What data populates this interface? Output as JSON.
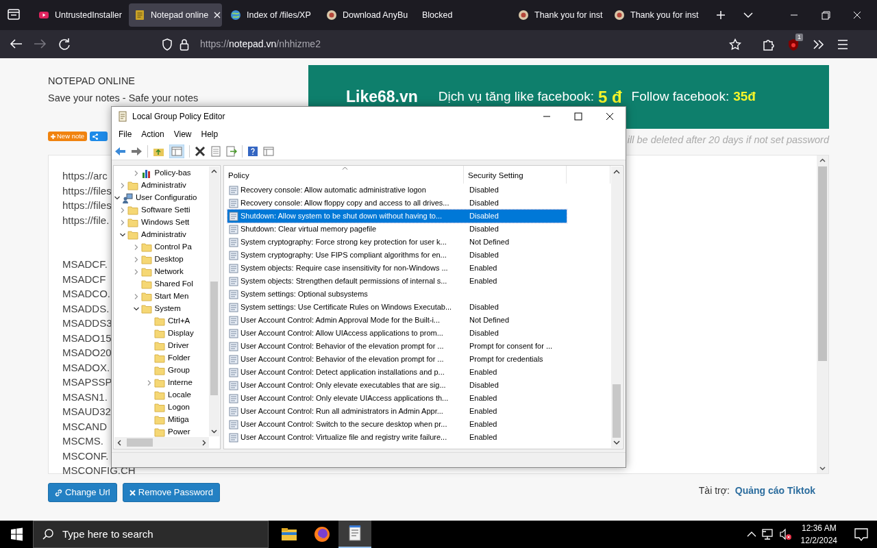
{
  "browser": {
    "tabs": [
      {
        "title": "UntrustedInstaller",
        "selected": false,
        "kind": "video"
      },
      {
        "title": "Notepad online",
        "selected": true,
        "kind": "note"
      },
      {
        "title": "Index of /files/XP",
        "selected": false,
        "kind": "globe"
      },
      {
        "title": "Download AnyBu",
        "selected": false,
        "kind": "site"
      },
      {
        "title": "Blocked",
        "selected": false,
        "kind": "plain"
      },
      {
        "title": "Thank you for inst",
        "selected": false,
        "kind": "site"
      },
      {
        "title": "Thank you for inst",
        "selected": false,
        "kind": "site"
      }
    ],
    "url": {
      "scheme": "https://",
      "host": "notepad.vn",
      "path": "/nhhizme2"
    },
    "extension_badge": "1"
  },
  "page": {
    "title": "NOTEPAD ONLINE",
    "subtitle": "Save your notes - Safe your notes",
    "new_note": "New note",
    "banner": {
      "brand": "Like68.vn",
      "offer_1": "Dịch vụ tăng like facebook:",
      "price_1": "5 đ",
      "offer_2": "Follow facebook:",
      "price_2": "35đ"
    },
    "notice": "ill be deleted after 20 days if not set password",
    "note_blocks": [
      [
        "https://arc",
        "https://files",
        "https://files",
        "https://file."
      ],
      [
        "MSADCF.",
        "MSADCF",
        "MSADCO.",
        "MSADDS.",
        "MSADDS3",
        "MSADO15",
        "MSADO20",
        "MSADOX.",
        "MSAPSSP",
        "MSASN1.",
        "MSAUD32",
        "MSCAND",
        "MSCMS.",
        "MSCONF.",
        "MSCONFIG.CH"
      ]
    ],
    "buttons": [
      {
        "label": "Change Url",
        "kind": "link"
      },
      {
        "label": "Remove Password",
        "kind": "remove"
      }
    ],
    "sponsor": {
      "label": "Tài trợ:",
      "link": "Quảng cáo Tiktok"
    }
  },
  "dialog": {
    "title": "Local Group Policy Editor",
    "menu": [
      "File",
      "Action",
      "View",
      "Help"
    ],
    "tree": [
      {
        "children": [
          {
            "children": [
              {
                "label": "Policy-bas",
                "expanded": false,
                "kind": "chart"
              }
            ]
          },
          {
            "label": "Administrativ",
            "expanded": false,
            "kind": "folder"
          }
        ]
      },
      {
        "label": "User Configuratio",
        "expanded": true,
        "kind": "user",
        "children": [
          {
            "label": "Software Setti",
            "expanded": false,
            "kind": "folder"
          },
          {
            "label": "Windows Sett",
            "expanded": false,
            "kind": "folder"
          },
          {
            "label": "Administrativ",
            "expanded": true,
            "kind": "folder",
            "children": [
              {
                "label": "Control Pa",
                "expanded": false,
                "kind": "folder"
              },
              {
                "label": "Desktop",
                "expanded": false,
                "kind": "folder"
              },
              {
                "label": "Network",
                "expanded": false,
                "kind": "folder"
              },
              {
                "label": "Shared Fol",
                "kind": "folder"
              },
              {
                "label": "Start Men",
                "expanded": false,
                "kind": "folder"
              },
              {
                "label": "System",
                "expanded": true,
                "kind": "folder",
                "children": [
                  {
                    "label": "Ctrl+A",
                    "kind": "folder"
                  },
                  {
                    "label": "Display",
                    "kind": "folder"
                  },
                  {
                    "label": "Driver",
                    "kind": "folder"
                  },
                  {
                    "label": "Folder",
                    "kind": "folder"
                  },
                  {
                    "label": "Group",
                    "kind": "folder"
                  },
                  {
                    "label": "Interne",
                    "expanded": false,
                    "kind": "folder"
                  },
                  {
                    "label": "Locale",
                    "kind": "folder"
                  },
                  {
                    "label": "Logon",
                    "kind": "folder"
                  },
                  {
                    "label": "Mitiga",
                    "kind": "folder"
                  },
                  {
                    "label": "Power",
                    "kind": "folder"
                  }
                ]
              }
            ]
          }
        ]
      }
    ],
    "columns": [
      "Policy",
      "Security Setting"
    ],
    "rows": [
      {
        "policy": "Recovery console: Allow automatic administrative logon",
        "setting": "Disabled",
        "selected": false
      },
      {
        "policy": "Recovery console: Allow floppy copy and access to all drives...",
        "setting": "Disabled",
        "selected": false
      },
      {
        "policy": "Shutdown: Allow system to be shut down without having to...",
        "setting": "Disabled",
        "selected": true
      },
      {
        "policy": "Shutdown: Clear virtual memory pagefile",
        "setting": "Disabled",
        "selected": false
      },
      {
        "policy": "System cryptography: Force strong key protection for user k...",
        "setting": "Not Defined",
        "selected": false
      },
      {
        "policy": "System cryptography: Use FIPS compliant algorithms for en...",
        "setting": "Disabled",
        "selected": false
      },
      {
        "policy": "System objects: Require case insensitivity for non-Windows ...",
        "setting": "Enabled",
        "selected": false
      },
      {
        "policy": "System objects: Strengthen default permissions of internal s...",
        "setting": "Enabled",
        "selected": false
      },
      {
        "policy": "System settings: Optional subsystems",
        "selected": false
      },
      {
        "policy": "System settings: Use Certificate Rules on Windows Executab...",
        "setting": "Disabled",
        "selected": false
      },
      {
        "policy": "User Account Control: Admin Approval Mode for the Built-i...",
        "setting": "Not Defined",
        "selected": false
      },
      {
        "policy": "User Account Control: Allow UIAccess applications to prom...",
        "setting": "Disabled",
        "selected": false
      },
      {
        "policy": "User Account Control: Behavior of the elevation prompt for ...",
        "setting": "Prompt for consent for ...",
        "selected": false
      },
      {
        "policy": "User Account Control: Behavior of the elevation prompt for ...",
        "setting": "Prompt for credentials",
        "selected": false
      },
      {
        "policy": "User Account Control: Detect application installations and p...",
        "setting": "Enabled",
        "selected": false
      },
      {
        "policy": "User Account Control: Only elevate executables that are sig...",
        "setting": "Disabled",
        "selected": false
      },
      {
        "policy": "User Account Control: Only elevate UIAccess applications th...",
        "setting": "Enabled",
        "selected": false
      },
      {
        "policy": "User Account Control: Run all administrators in Admin Appr...",
        "setting": "Enabled",
        "selected": false
      },
      {
        "policy": "User Account Control: Switch to the secure desktop when pr...",
        "setting": "Enabled",
        "selected": false
      },
      {
        "policy": "User Account Control: Virtualize file and registry write failure...",
        "setting": "Enabled",
        "selected": false
      }
    ]
  },
  "taskbar": {
    "search": {
      "placeholder": "Type here to search"
    },
    "apps": [
      {
        "kind": "explorer",
        "selected": false
      },
      {
        "kind": "firefox",
        "selected": false
      },
      {
        "kind": "notepad",
        "selected": true
      }
    ],
    "time": "12:36 AM",
    "date": "12/2/2024"
  }
}
